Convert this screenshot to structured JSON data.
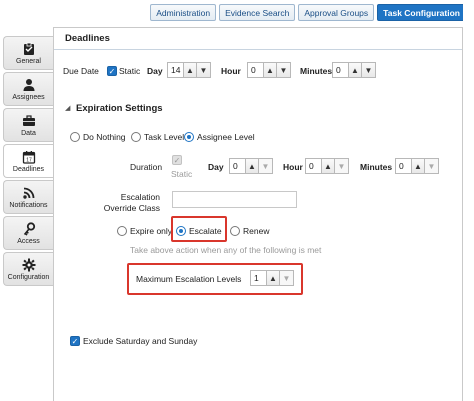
{
  "nav": {
    "administration": "Administration",
    "evidence_search": "Evidence Search",
    "approval_groups": "Approval Groups",
    "task_configuration": "Task Configuration"
  },
  "tabs": [
    {
      "label": "General",
      "icon": "clipboard-icon"
    },
    {
      "label": "Assignees",
      "icon": "person-icon"
    },
    {
      "label": "Data",
      "icon": "briefcase-icon"
    },
    {
      "label": "Deadlines",
      "icon": "calendar-icon",
      "active": true
    },
    {
      "label": "Notifications",
      "icon": "rss-icon"
    },
    {
      "label": "Access",
      "icon": "key-icon"
    },
    {
      "label": "Configuration",
      "icon": "gear-icon"
    }
  ],
  "panel": {
    "title": "Deadlines",
    "due_date": {
      "label": "Due Date",
      "static_label": "Static",
      "day_label": "Day",
      "day_value": "14",
      "hour_label": "Hour",
      "hour_value": "0",
      "minutes_label": "Minutes",
      "minutes_value": "0"
    },
    "expiration": {
      "title": "Expiration Settings",
      "options": [
        "Do Nothing",
        "Task Level",
        "Assignee Level"
      ],
      "selected": "Assignee Level",
      "duration_label": "Duration",
      "static_label": "Static",
      "day_label": "Day",
      "day_value": "0",
      "hour_label": "Hour",
      "hour_value": "0",
      "minutes_label": "Minutes",
      "minutes_value": "0",
      "escalation_override_label": "Escalation Override Class",
      "escalation_override_value": "",
      "action_options": [
        "Expire only",
        "Escalate",
        "Renew"
      ],
      "action_selected": "Escalate",
      "hint": "Take above action when any of the following is met",
      "max_escalation_label": "Maximum Escalation Levels",
      "max_escalation_value": "1"
    },
    "exclude_weekends_label": "Exclude Saturday and Sunday"
  },
  "colors": {
    "accent": "#1f74c4",
    "highlight": "#d9362c"
  }
}
